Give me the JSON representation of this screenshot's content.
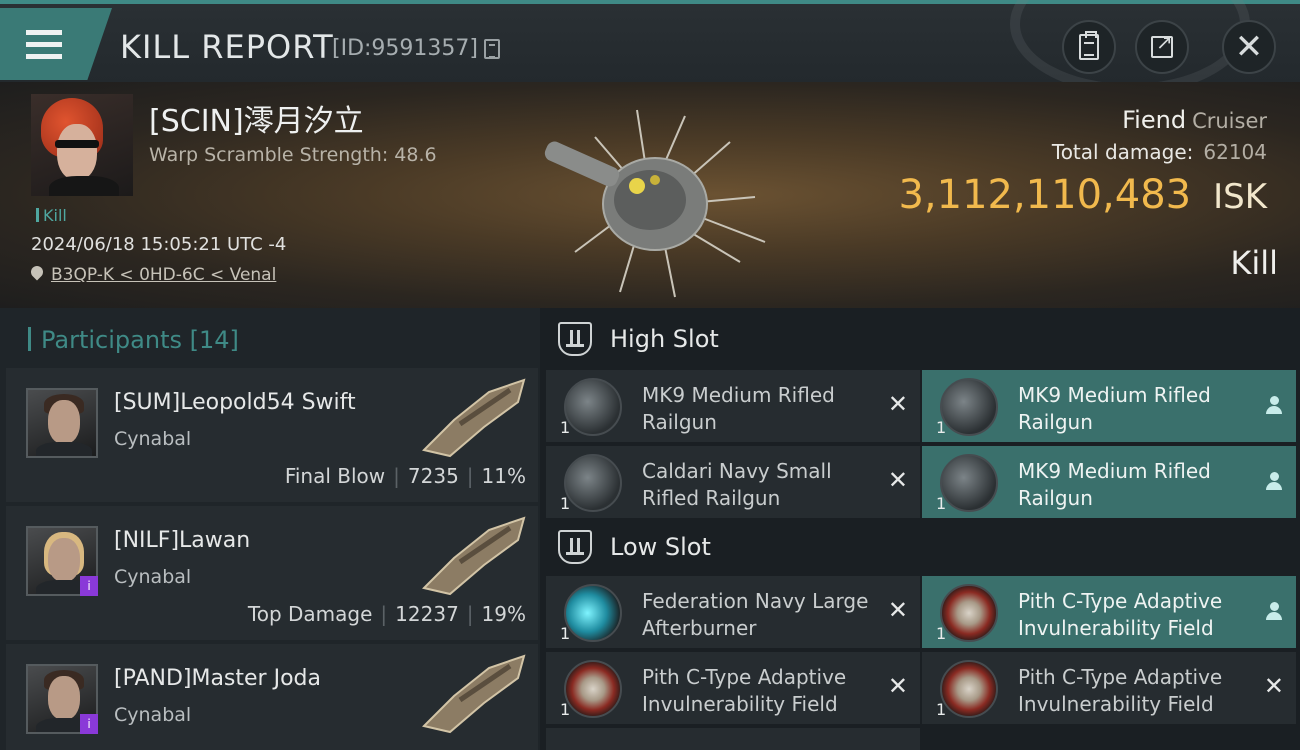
{
  "header": {
    "title": "KILL REPORT",
    "report_id": "[ID:9591357]"
  },
  "victim": {
    "name": "[SCIN]澪月汐立",
    "subtitle": "Warp Scramble Strength: 48.6",
    "tag": "Kill",
    "datetime": "2024/06/18 15:05:21 UTC -4",
    "location": "B3QP-K < 0HD-6C < Venal",
    "ship_name": "Fiend",
    "ship_class": "Cruiser",
    "total_damage_label": "Total damage:",
    "total_damage": "62104",
    "isk_value": "3,112,110,483",
    "isk_unit": "ISK",
    "result": "Kill"
  },
  "participants": {
    "label": "Participants",
    "count": "[14]",
    "items": [
      {
        "name": "[SUM]Leopold54 Swift",
        "ship": "Cynabal",
        "role": "Final Blow",
        "damage": "7235",
        "percent": "11%",
        "badge": ""
      },
      {
        "name": "[NILF]Lawan",
        "ship": "Cynabal",
        "role": "Top Damage",
        "damage": "12237",
        "percent": "19%",
        "badge": "i"
      },
      {
        "name": "[PAND]Master Joda",
        "ship": "Cynabal",
        "role": "",
        "damage": "",
        "percent": "",
        "badge": "i"
      }
    ]
  },
  "slots": {
    "high": {
      "label": "High Slot",
      "items": [
        {
          "name": "MK9 Medium Rifled Railgun",
          "qty": "1",
          "icon": "railgun-icon"
        },
        {
          "name": "MK9 Medium Rifled Railgun",
          "qty": "1",
          "icon": "railgun-icon"
        },
        {
          "name": "Caldari Navy Small Rifled Railgun",
          "qty": "1",
          "icon": "railgun-icon"
        },
        {
          "name": "MK9 Medium Rifled Railgun",
          "qty": "1",
          "icon": "railgun-icon"
        }
      ]
    },
    "low": {
      "label": "Low Slot",
      "items": [
        {
          "name": "Federation Navy Large Afterburner",
          "qty": "1",
          "icon": "afterburner-icon"
        },
        {
          "name": "Pith C-Type Adaptive Invulnerability Field",
          "qty": "1",
          "icon": "shield-module-icon"
        },
        {
          "name": "Pith C-Type Adaptive Invulnerability Field",
          "qty": "1",
          "icon": "shield-module-icon"
        },
        {
          "name": "Pith C-Type Adaptive Invulnerability Field",
          "qty": "1",
          "icon": "shield-module-icon"
        }
      ]
    }
  },
  "colors": {
    "accent": "#3f8a86",
    "isk": "#f1b94d",
    "highlight_row": "#3a706c"
  }
}
